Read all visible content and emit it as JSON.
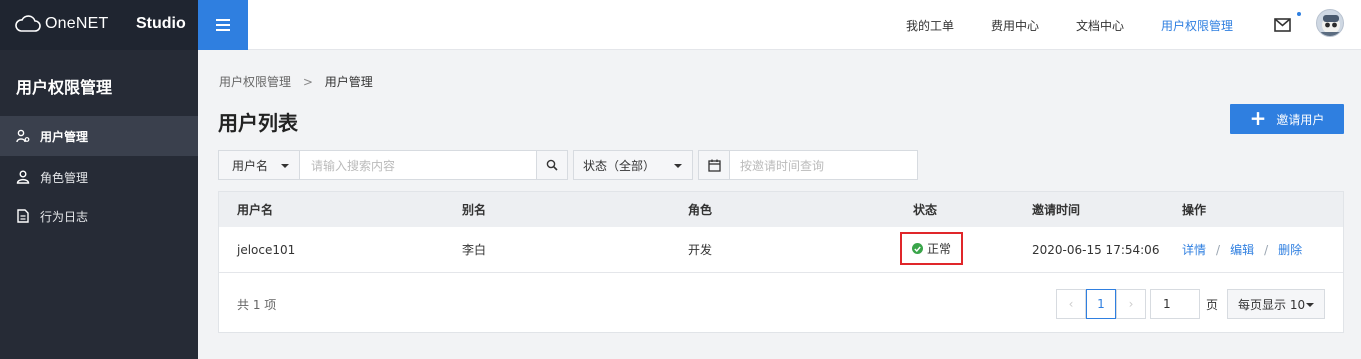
{
  "header": {
    "logo_text": "OneNET",
    "studio_label": "Studio",
    "nav": [
      {
        "label": "我的工单"
      },
      {
        "label": "费用中心"
      },
      {
        "label": "文档中心"
      },
      {
        "label": "用户权限管理",
        "active": true
      }
    ],
    "accent_color": "#2f7fe0"
  },
  "sidebar": {
    "title": "用户权限管理",
    "items": [
      {
        "label": "用户管理",
        "icon": "user-settings-icon",
        "active": true
      },
      {
        "label": "角色管理",
        "icon": "person-icon"
      },
      {
        "label": "行为日志",
        "icon": "document-icon"
      }
    ]
  },
  "breadcrumb": {
    "parent": "用户权限管理",
    "separator": ">",
    "current": "用户管理"
  },
  "main": {
    "title": "用户列表",
    "invite_label": "邀请用户"
  },
  "filters": {
    "field_select": "用户名",
    "search_placeholder": "请输入搜索内容",
    "status_select": "状态（全部）",
    "date_placeholder": "按邀请时间查询"
  },
  "table": {
    "columns": [
      "用户名",
      "别名",
      "角色",
      "状态",
      "邀请时间",
      "操作"
    ],
    "rows": [
      {
        "username": "jeloce101",
        "alias": "李白",
        "role": "开发",
        "status": "正常",
        "invite_time": "2020-06-15 17:54:06",
        "actions": [
          "详情",
          "编辑",
          "删除"
        ]
      }
    ]
  },
  "pagination": {
    "total_text": "共 1 项",
    "prev": "‹",
    "current_page": "1",
    "next": "›",
    "jump_value": "1",
    "page_unit": "页",
    "page_size_label": "每页显示 10"
  }
}
